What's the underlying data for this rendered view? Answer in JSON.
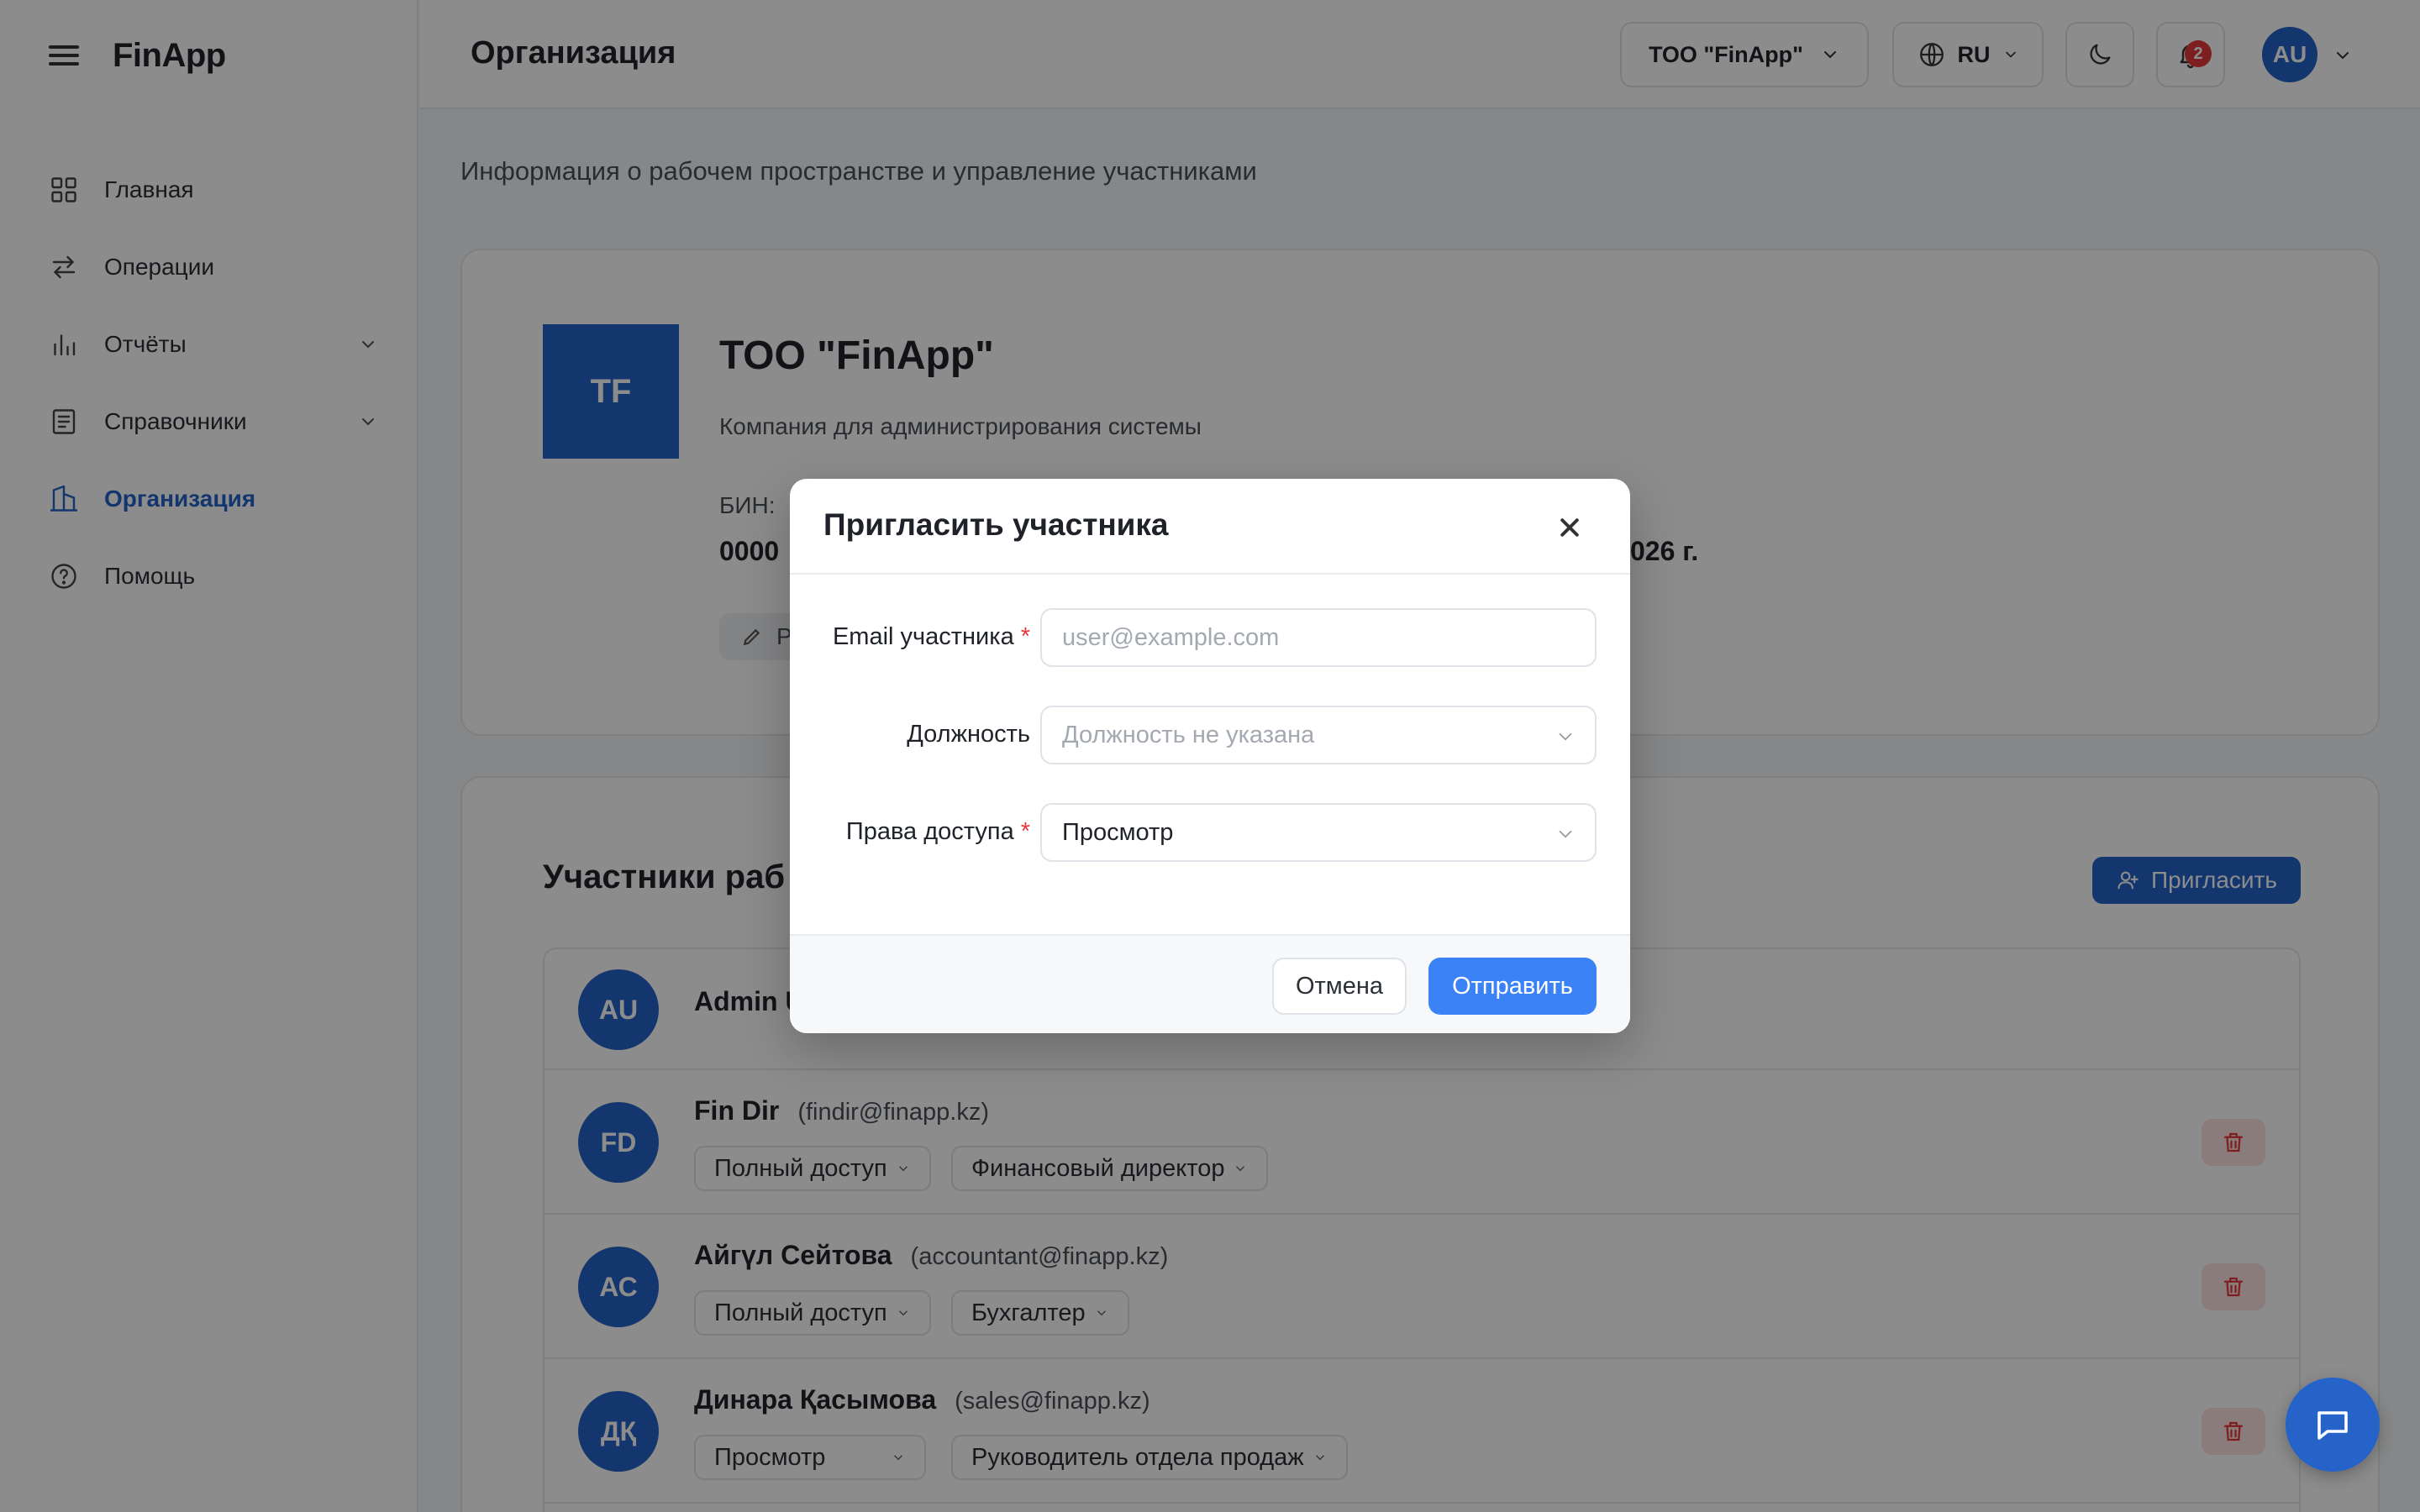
{
  "app": {
    "brand": "FinApp"
  },
  "sidebar": {
    "items": [
      {
        "label": "Главная",
        "icon": "grid-icon"
      },
      {
        "label": "Операции",
        "icon": "arrows-icon"
      },
      {
        "label": "Отчёты",
        "icon": "bar-chart-icon",
        "expandable": true
      },
      {
        "label": "Справочники",
        "icon": "book-icon",
        "expandable": true
      },
      {
        "label": "Организация",
        "icon": "building-icon",
        "active": true
      },
      {
        "label": "Помощь",
        "icon": "help-icon"
      }
    ]
  },
  "topbar": {
    "title": "Организация",
    "org_selector": "ТОО \"FinApp\"",
    "language": "RU",
    "notifications_count": "2",
    "user_initials": "AU"
  },
  "page": {
    "subtitle": "Информация о рабочем пространстве и управление участниками"
  },
  "organization": {
    "logo_initials": "TF",
    "name": "ТОО \"FinApp\"",
    "description": "Компания для администрирования системы",
    "bin_label": "БИН:",
    "bin_value_visible": "0000",
    "date_label_visible": "",
    "date_value_visible": "026 г.",
    "edit_label_visible": "Р"
  },
  "members": {
    "title_visible": "Участники раб",
    "invite_label": "Пригласить",
    "rows": [
      {
        "initials": "AU",
        "name": "Admin U",
        "email": "",
        "tags": []
      },
      {
        "initials": "FD",
        "name": "Fin Dir",
        "email": "(findir@finapp.kz)",
        "tags": [
          "Полный доступ",
          "Финансовый директор"
        ]
      },
      {
        "initials": "АС",
        "name": "Айгүл Сейтова",
        "email": "(accountant@finapp.kz)",
        "tags": [
          "Полный доступ",
          "Бухгалтер"
        ]
      },
      {
        "initials": "ДҚ",
        "name": "Динара Қасымова",
        "email": "(sales@finapp.kz)",
        "tags": [
          "Просмотр",
          "Руководитель отдела продаж"
        ]
      }
    ]
  },
  "modal": {
    "title": "Пригласить участника",
    "email": {
      "label": "Email участника",
      "placeholder": "user@example.com",
      "value": ""
    },
    "position": {
      "label": "Должность",
      "value": "Должность не указана"
    },
    "access": {
      "label": "Права доступа",
      "value": "Просмотр"
    },
    "cancel_label": "Отмена",
    "submit_label": "Отправить"
  },
  "colors": {
    "accent": "#2563c9",
    "primary_button": "#3b82f6",
    "danger": "#e5383b"
  }
}
